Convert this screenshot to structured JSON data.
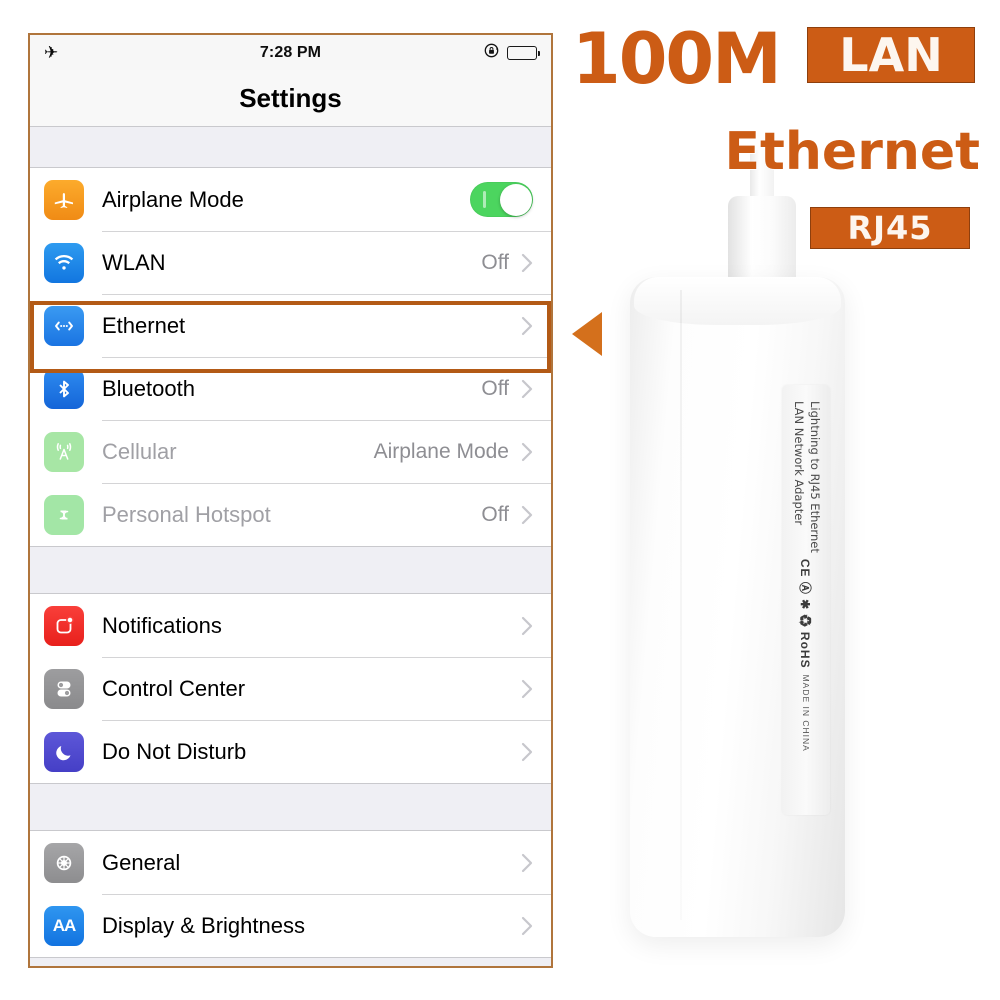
{
  "phone": {
    "status_bar": {
      "airplane_icon": "airplane-icon",
      "time": "7:28 PM",
      "rotation_lock_icon": "rotation-lock-icon",
      "battery_icon": "battery-icon"
    },
    "nav": {
      "title": "Settings"
    },
    "groups": [
      {
        "rows": [
          {
            "icon": "airplane-icon",
            "label": "Airplane Mode",
            "value": "",
            "control": "toggle",
            "toggle_on": true,
            "dim": false
          },
          {
            "icon": "wifi-icon",
            "label": "WLAN",
            "value": "Off",
            "control": "chevron",
            "dim": false
          },
          {
            "icon": "ethernet-icon",
            "label": "Ethernet",
            "value": "",
            "control": "chevron",
            "dim": false,
            "highlighted": true
          },
          {
            "icon": "bluetooth-icon",
            "label": "Bluetooth",
            "value": "Off",
            "control": "chevron",
            "dim": false
          },
          {
            "icon": "cellular-icon",
            "label": "Cellular",
            "value": "Airplane Mode",
            "control": "chevron",
            "dim": true
          },
          {
            "icon": "hotspot-icon",
            "label": "Personal Hotspot",
            "value": "Off",
            "control": "chevron",
            "dim": true
          }
        ]
      },
      {
        "rows": [
          {
            "icon": "notifications-icon",
            "label": "Notifications",
            "value": "",
            "control": "chevron",
            "dim": false
          },
          {
            "icon": "control-center-icon",
            "label": "Control Center",
            "value": "",
            "control": "chevron",
            "dim": false
          },
          {
            "icon": "moon-icon",
            "label": "Do Not Disturb",
            "value": "",
            "control": "chevron",
            "dim": false
          }
        ]
      },
      {
        "rows": [
          {
            "icon": "gear-icon",
            "label": "General",
            "value": "",
            "control": "chevron",
            "dim": false
          },
          {
            "icon": "brightness-icon",
            "label": "Display & Brightness",
            "value": "",
            "control": "chevron",
            "dim": false
          }
        ]
      }
    ]
  },
  "promo": {
    "speed": "100M",
    "lan_badge": "LAN",
    "ethernet": "Ethernet",
    "rj45_badge": "RJ45",
    "arrow_icon": "left-arrow-marker-icon"
  },
  "device": {
    "label_line1": "Lightning to RJ45 Ethernet",
    "label_line2": "LAN Network Adapter",
    "label_marks": "CE Ⓐ ✱ ♻ RoHS",
    "label_origin": "MADE IN CHINA"
  },
  "colors": {
    "brand_orange": "#cc5c15",
    "highlight_border": "#b35a16",
    "frame_border": "#b0753c",
    "toggle_green": "#4cd55f",
    "ios_gray_bg": "#efeff4",
    "value_gray": "#8e8e93"
  }
}
